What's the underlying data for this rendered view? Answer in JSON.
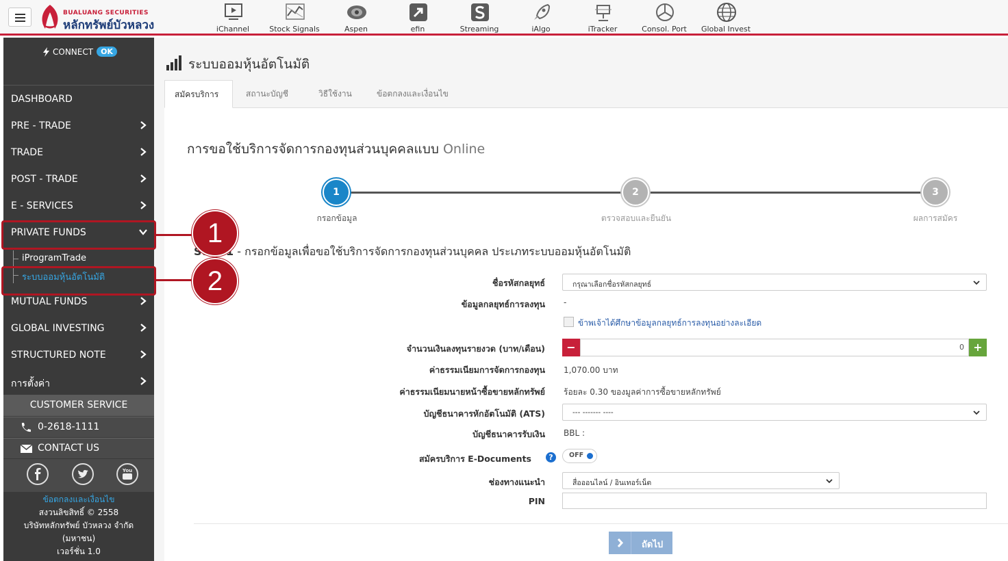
{
  "topbar": {
    "logo": {
      "small_text": "BUALUANG SECURITIES",
      "main_text": "หลักทรัพย์บัวหลวง"
    },
    "apps": [
      {
        "label": "iChannel",
        "icon": "monitor-icon"
      },
      {
        "label": "Stock Signals",
        "icon": "signal-chart-icon"
      },
      {
        "label": "Aspen",
        "icon": "globe-eye-icon"
      },
      {
        "label": "efin",
        "icon": "efin-arrow-icon"
      },
      {
        "label": "Streaming",
        "icon": "streaming-s-icon"
      },
      {
        "label": "iAlgo",
        "icon": "rocket-icon"
      },
      {
        "label": "iTracker",
        "icon": "tracker-icon"
      },
      {
        "label": "Consol. Port",
        "icon": "pie-chart-icon"
      },
      {
        "label": "Global Invest",
        "icon": "world-globe-icon"
      }
    ]
  },
  "sidebar": {
    "connect": {
      "label": "CONNECT",
      "status": "OK"
    },
    "menu": [
      {
        "label": "DASHBOARD",
        "chevron": false
      },
      {
        "label": "PRE - TRADE",
        "chevron": true
      },
      {
        "label": "TRADE",
        "chevron": true
      },
      {
        "label": "POST - TRADE",
        "chevron": true
      },
      {
        "label": "E - SERVICES",
        "chevron": true
      },
      {
        "label": "PRIVATE FUNDS",
        "chevron": true
      },
      {
        "label": "MUTUAL FUNDS",
        "chevron": true
      },
      {
        "label": "GLOBAL INVESTING",
        "chevron": true
      },
      {
        "label": "STRUCTURED NOTE",
        "chevron": true
      },
      {
        "label": "การตั้งค่า",
        "chevron": true
      }
    ],
    "submenu": [
      {
        "label": "iProgramTrade"
      },
      {
        "label": "ระบบออมหุ้นอัตโนมัติ"
      }
    ],
    "customer_service": {
      "title": "CUSTOMER SERVICE",
      "phone": "0-2618-1111",
      "contact": "CONTACT US"
    },
    "footer": {
      "terms": "ข้อตกลงและเงื่อนไข",
      "copyright": "สงวนลิขสิทธิ์ © 2558",
      "company": "บริษัทหลักทรัพย์ บัวหลวง จำกัด",
      "company2": "(มหาชน)",
      "version": "เวอร์ชั่น 1.0"
    }
  },
  "main": {
    "page_title": "ระบบออมหุ้นอัตโนมัติ",
    "tabs": [
      {
        "label": "สมัครบริการ",
        "active": true
      },
      {
        "label": "สถานะบัญชี",
        "active": false
      },
      {
        "label": "วิธีใช้งาน",
        "active": false
      },
      {
        "label": "ข้อตกลงและเงื่อนไข",
        "active": false
      }
    ],
    "form_heading": "การขอใช้บริการจัดการกองทุนส่วนบุคคลแบบ",
    "form_heading_en": "Online",
    "steps": [
      {
        "number": "1",
        "label": "กรอกข้อมูล",
        "state": "current"
      },
      {
        "number": "2",
        "label": "ตรวจสอบและยืนยัน",
        "state": "pending"
      },
      {
        "number": "3",
        "label": "ผลการสมัคร",
        "state": "pending"
      }
    ],
    "step_title_prefix": "Step 1",
    "step_title": " - กรอกข้อมูลเพื่อขอใช้บริการจัดการกองทุนส่วนบุคคล ประเภทระบบออมหุ้นอัตโนมัติ",
    "form": {
      "strategy_label": "ชื่อรหัสกลยุทธ์",
      "strategy_placeholder": "กรุณาเลือกชื่อรหัสกลยุทธ์",
      "strategy_info_label": "ข้อมูลกลยุทธ์การลงทุน",
      "strategy_info_value": "-",
      "consent_text": "ข้าพเจ้าได้ศึกษาข้อมูลกลยุทธ์การลงทุนอย่างละเอียด",
      "amount_label": "จำนวนเงินลงทุนรายงวด (บาท/เดือน)",
      "amount_value": "0",
      "minus": "−",
      "plus": "+",
      "mgmt_fee_label": "ค่าธรรมเนียมการจัดการกองทุน",
      "mgmt_fee_value": "1,070.00 บาท",
      "broker_fee_label": "ค่าธรรมเนียมนายหน้าซื้อขายหลักทรัพย์",
      "broker_fee_value": "ร้อยละ 0.30 ของมูลค่าการซื้อขายหลักทรัพย์",
      "ats_label": "บัญชีธนาคารหักอัตโนมัติ (ATS)",
      "ats_value": "--- ------- ----",
      "receive_label": "บัญชีธนาคารรับเงิน",
      "receive_value": "BBL :",
      "edoc_label": "สมัครบริการ E-Documents",
      "edoc_toggle": "OFF",
      "edoc_help": "?",
      "channel_label": "ช่องทางแนะนำ",
      "channel_value": "สื่อออนไลน์ / อินเทอร์เน็ต",
      "pin_label": "PIN"
    },
    "next_button": "ถัดไป"
  },
  "annotations": [
    {
      "number": "1"
    },
    {
      "number": "2"
    }
  ],
  "colors": {
    "brand_red": "#c8203a",
    "sidebar_bg": "#3a3a3a",
    "accent_blue": "#1c6fcf",
    "annotation_red": "#b01622",
    "link_blue": "#36a6e3"
  }
}
